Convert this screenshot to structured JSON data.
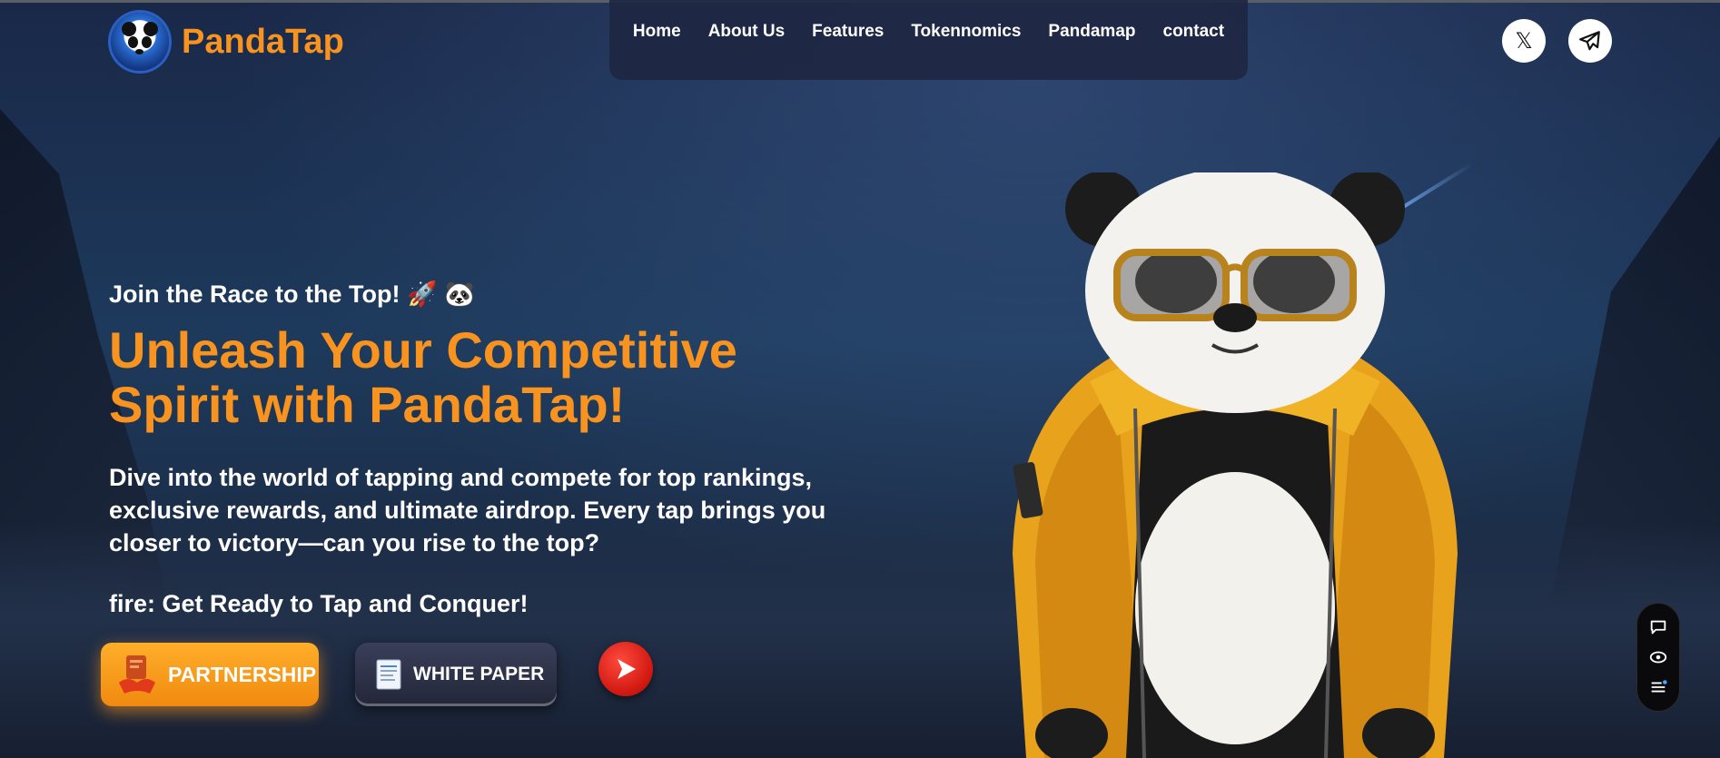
{
  "brand": {
    "name": "PandaTap",
    "color": "#f7931e"
  },
  "nav": {
    "items": [
      {
        "label": "Home"
      },
      {
        "label": "About Us"
      },
      {
        "label": "Features"
      },
      {
        "label": "Tokennomics"
      },
      {
        "label": "Pandamap"
      },
      {
        "label": "contact"
      }
    ]
  },
  "social": [
    {
      "icon": "x-logo-icon",
      "label": "𝕏"
    },
    {
      "icon": "telegram-icon"
    }
  ],
  "hero": {
    "kicker": "Join the Race to the Top! 🚀 🐼",
    "title": "Unleash Your Competitive Spirit with PandaTap!",
    "description": "Dive into the world of tapping and compete for top rankings, exclusive rewards, and ultimate airdrop. Every tap brings you closer to victory—can you rise to the top?",
    "fire_line": "fire: Get Ready to Tap and Conquer!"
  },
  "buttons": {
    "partnership": "PARTNERSHIP",
    "white_paper": "WHITE PAPER"
  },
  "widget": {
    "icons": [
      "chat-icon",
      "eye-icon",
      "menu-icon"
    ]
  },
  "colors": {
    "accent": "#f7931e",
    "play_red": "#d21a12",
    "jacket_yellow": "#e9a21b"
  }
}
